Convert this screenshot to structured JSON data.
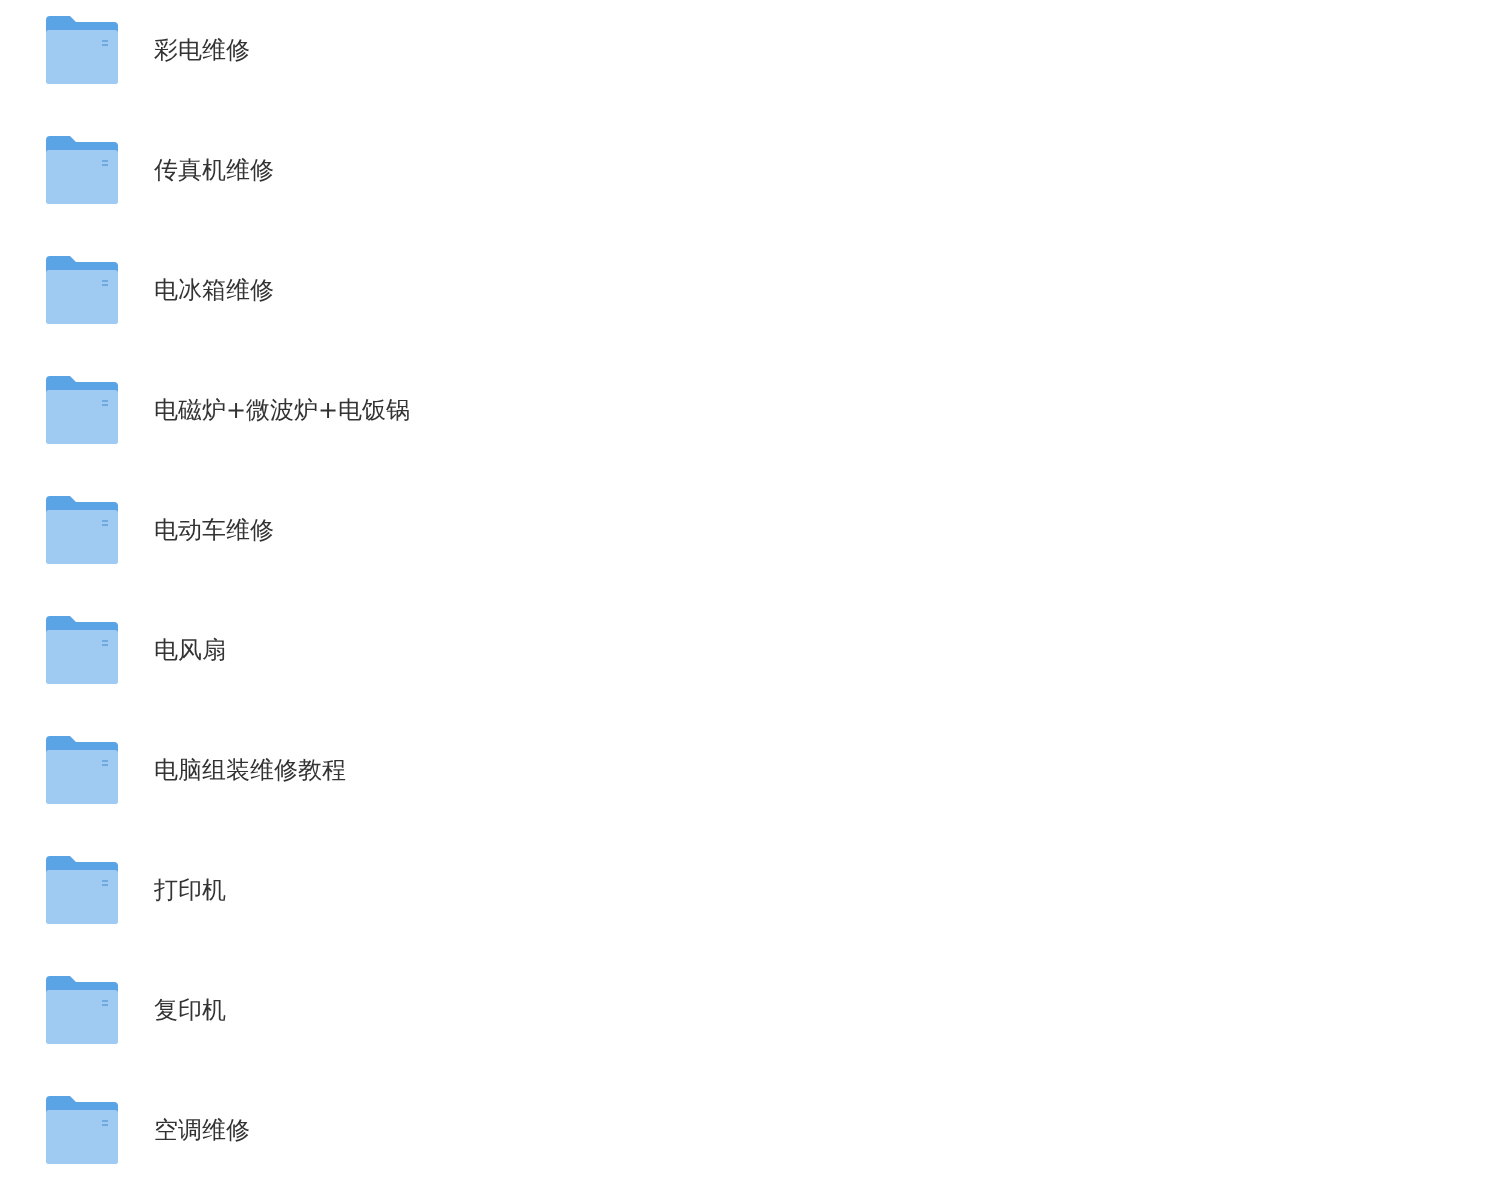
{
  "folders": [
    {
      "name": "彩电维修"
    },
    {
      "name": "传真机维修"
    },
    {
      "name": "电冰箱维修"
    },
    {
      "name": "电磁炉+微波炉+电饭锅"
    },
    {
      "name": "电动车维修"
    },
    {
      "name": "电风扇"
    },
    {
      "name": "电脑组装维修教程"
    },
    {
      "name": "打印机"
    },
    {
      "name": "复印机"
    },
    {
      "name": "空调维修"
    }
  ]
}
